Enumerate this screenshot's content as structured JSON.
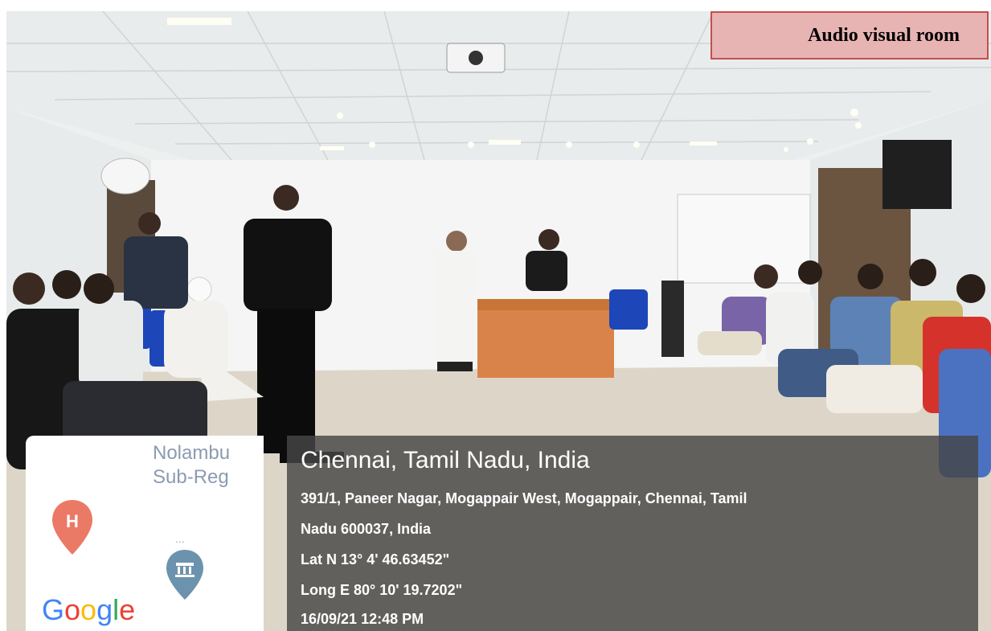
{
  "caption": {
    "text": "Audio visual room"
  },
  "map": {
    "place_line1": "Nolambu",
    "place_line2": "Sub-Reg",
    "hospital_letter": "H",
    "dots": "...",
    "logo_letters": [
      "G",
      "o",
      "o",
      "g",
      "l",
      "e"
    ],
    "logo_colors": [
      "#4285f4",
      "#ea4335",
      "#fbbc05",
      "#4285f4",
      "#34a853",
      "#ea4335"
    ]
  },
  "geo": {
    "title": "Chennai, Tamil Nadu, India",
    "address_line1": "391/1, Paneer Nagar, Mogappair West, Mogappair, Chennai, Tamil",
    "address_line2": "Nadu 600037, India",
    "lat": "Lat N 13° 4' 46.63452\"",
    "long": "Long E 80° 10' 19.7202\"",
    "timestamp": "16/09/21 12:48 PM"
  },
  "colors": {
    "caption_fill": "#e8b4b3",
    "caption_border": "#c0504d",
    "table_cloth": "#d9834a",
    "overlay": "#464646"
  }
}
